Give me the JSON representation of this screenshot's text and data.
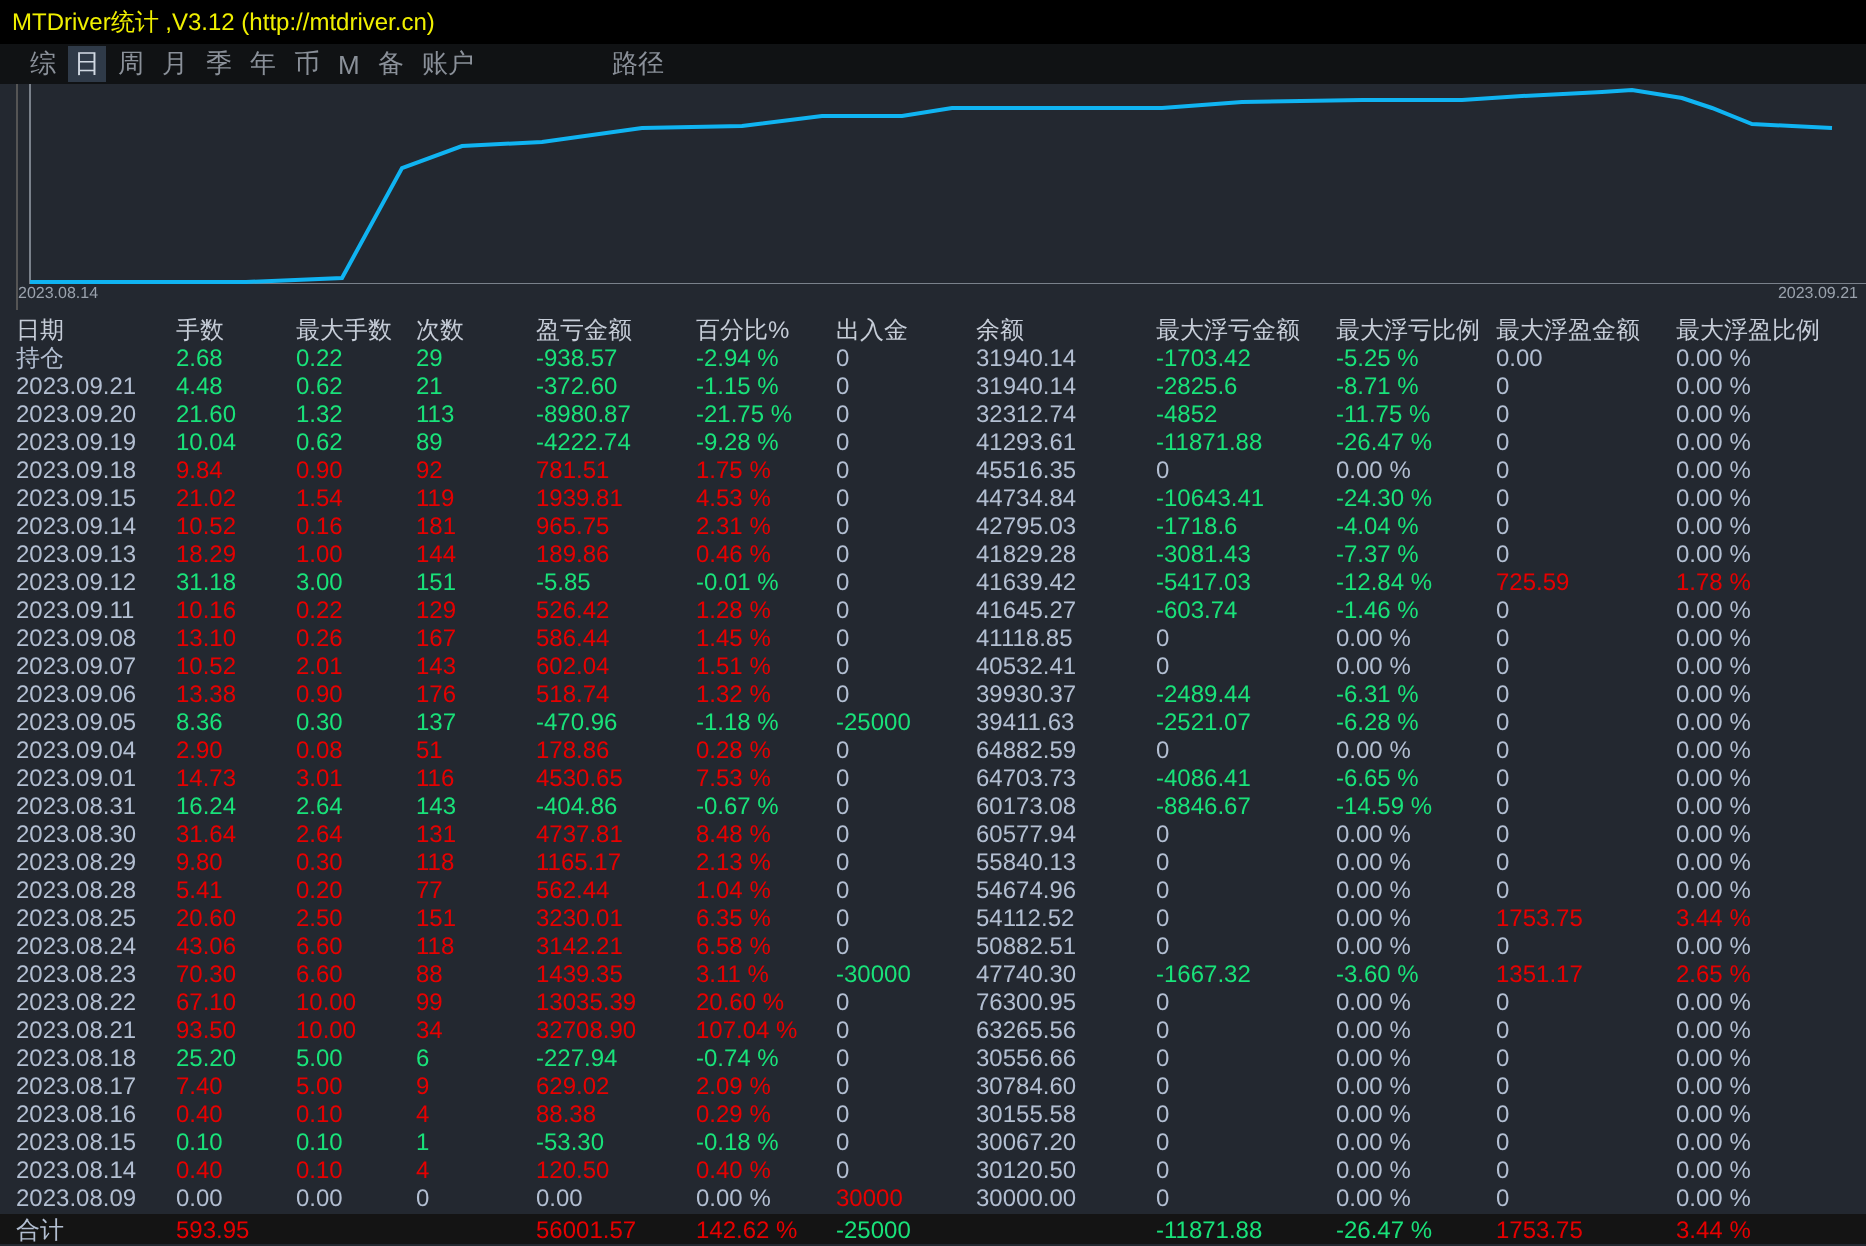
{
  "window": {
    "title": "MTDriver统计 ,V3.12 (http://mtdriver.cn)"
  },
  "tabs": [
    {
      "label": "综",
      "selected": false
    },
    {
      "label": "日",
      "selected": true
    },
    {
      "label": "周",
      "selected": false
    },
    {
      "label": "月",
      "selected": false
    },
    {
      "label": "季",
      "selected": false
    },
    {
      "label": "年",
      "selected": false
    },
    {
      "label": "币",
      "selected": false
    },
    {
      "label": "M",
      "selected": false
    },
    {
      "label": "备",
      "selected": false
    },
    {
      "label": "账户",
      "selected": false
    }
  ],
  "path_tab": {
    "label": "路径",
    "selected": false
  },
  "chart": {
    "start_label": "2023.08.14",
    "end_label": "2023.09.21"
  },
  "table": {
    "columns": [
      "日期",
      "手数",
      "最大手数",
      "次数",
      "盈亏金额",
      "百分比%",
      "出入金",
      "余额",
      "最大浮亏金额",
      "最大浮亏比例",
      "最大浮盈金额",
      "最大浮盈比例"
    ],
    "rows": [
      {
        "kind": "position",
        "cells": [
          {
            "text": "持仓",
            "color": "#b3bfd2"
          },
          {
            "text": "2.68",
            "color": "#19e27a"
          },
          {
            "text": "0.22",
            "color": "#19e27a"
          },
          {
            "text": "29",
            "color": "#19e27a"
          },
          {
            "text": "-938.57",
            "color": "#19e27a"
          },
          {
            "text": "-2.94 %",
            "color": "#19e27a"
          },
          {
            "text": "0",
            "color": "#b3bfd2"
          },
          {
            "text": "31940.14",
            "color": "#b3bfd2"
          },
          {
            "text": "-1703.42",
            "color": "#19e27a"
          },
          {
            "text": "-5.25 %",
            "color": "#19e27a"
          },
          {
            "text": "0.00",
            "color": "#b3bfd2"
          },
          {
            "text": "0.00 %",
            "color": "#b3bfd2"
          }
        ]
      },
      {
        "kind": "day",
        "cells": [
          {
            "text": "2023.09.21",
            "color": "#b3bfd2"
          },
          {
            "text": "4.48",
            "color": "#19e27a"
          },
          {
            "text": "0.62",
            "color": "#19e27a"
          },
          {
            "text": "21",
            "color": "#19e27a"
          },
          {
            "text": "-372.60",
            "color": "#19e27a"
          },
          {
            "text": "-1.15 %",
            "color": "#19e27a"
          },
          {
            "text": "0",
            "color": "#b3bfd2"
          },
          {
            "text": "31940.14",
            "color": "#b3bfd2"
          },
          {
            "text": "-2825.6",
            "color": "#19e27a"
          },
          {
            "text": "-8.71 %",
            "color": "#19e27a"
          },
          {
            "text": "0",
            "color": "#b3bfd2"
          },
          {
            "text": "0.00 %",
            "color": "#b3bfd2"
          }
        ]
      },
      {
        "kind": "day",
        "cells": [
          {
            "text": "2023.09.20",
            "color": "#b3bfd2"
          },
          {
            "text": "21.60",
            "color": "#19e27a"
          },
          {
            "text": "1.32",
            "color": "#19e27a"
          },
          {
            "text": "113",
            "color": "#19e27a"
          },
          {
            "text": "-8980.87",
            "color": "#19e27a"
          },
          {
            "text": "-21.75 %",
            "color": "#19e27a"
          },
          {
            "text": "0",
            "color": "#b3bfd2"
          },
          {
            "text": "32312.74",
            "color": "#b3bfd2"
          },
          {
            "text": "-4852",
            "color": "#19e27a"
          },
          {
            "text": "-11.75 %",
            "color": "#19e27a"
          },
          {
            "text": "0",
            "color": "#b3bfd2"
          },
          {
            "text": "0.00 %",
            "color": "#b3bfd2"
          }
        ]
      },
      {
        "kind": "day",
        "cells": [
          {
            "text": "2023.09.19",
            "color": "#b3bfd2"
          },
          {
            "text": "10.04",
            "color": "#19e27a"
          },
          {
            "text": "0.62",
            "color": "#19e27a"
          },
          {
            "text": "89",
            "color": "#19e27a"
          },
          {
            "text": "-4222.74",
            "color": "#19e27a"
          },
          {
            "text": "-9.28 %",
            "color": "#19e27a"
          },
          {
            "text": "0",
            "color": "#b3bfd2"
          },
          {
            "text": "41293.61",
            "color": "#b3bfd2"
          },
          {
            "text": "-11871.88",
            "color": "#19e27a"
          },
          {
            "text": "-26.47 %",
            "color": "#19e27a"
          },
          {
            "text": "0",
            "color": "#b3bfd2"
          },
          {
            "text": "0.00 %",
            "color": "#b3bfd2"
          }
        ]
      },
      {
        "kind": "day",
        "cells": [
          {
            "text": "2023.09.18",
            "color": "#b3bfd2"
          },
          {
            "text": "9.84",
            "color": "#e60000"
          },
          {
            "text": "0.90",
            "color": "#e60000"
          },
          {
            "text": "92",
            "color": "#e60000"
          },
          {
            "text": "781.51",
            "color": "#e60000"
          },
          {
            "text": "1.75 %",
            "color": "#e60000"
          },
          {
            "text": "0",
            "color": "#b3bfd2"
          },
          {
            "text": "45516.35",
            "color": "#b3bfd2"
          },
          {
            "text": "0",
            "color": "#b3bfd2"
          },
          {
            "text": "0.00 %",
            "color": "#b3bfd2"
          },
          {
            "text": "0",
            "color": "#b3bfd2"
          },
          {
            "text": "0.00 %",
            "color": "#b3bfd2"
          }
        ]
      },
      {
        "kind": "day",
        "cells": [
          {
            "text": "2023.09.15",
            "color": "#b3bfd2"
          },
          {
            "text": "21.02",
            "color": "#e60000"
          },
          {
            "text": "1.54",
            "color": "#e60000"
          },
          {
            "text": "119",
            "color": "#e60000"
          },
          {
            "text": "1939.81",
            "color": "#e60000"
          },
          {
            "text": "4.53 %",
            "color": "#e60000"
          },
          {
            "text": "0",
            "color": "#b3bfd2"
          },
          {
            "text": "44734.84",
            "color": "#b3bfd2"
          },
          {
            "text": "-10643.41",
            "color": "#19e27a"
          },
          {
            "text": "-24.30 %",
            "color": "#19e27a"
          },
          {
            "text": "0",
            "color": "#b3bfd2"
          },
          {
            "text": "0.00 %",
            "color": "#b3bfd2"
          }
        ]
      },
      {
        "kind": "day",
        "cells": [
          {
            "text": "2023.09.14",
            "color": "#b3bfd2"
          },
          {
            "text": "10.52",
            "color": "#e60000"
          },
          {
            "text": "0.16",
            "color": "#e60000"
          },
          {
            "text": "181",
            "color": "#e60000"
          },
          {
            "text": "965.75",
            "color": "#e60000"
          },
          {
            "text": "2.31 %",
            "color": "#e60000"
          },
          {
            "text": "0",
            "color": "#b3bfd2"
          },
          {
            "text": "42795.03",
            "color": "#b3bfd2"
          },
          {
            "text": "-1718.6",
            "color": "#19e27a"
          },
          {
            "text": "-4.04 %",
            "color": "#19e27a"
          },
          {
            "text": "0",
            "color": "#b3bfd2"
          },
          {
            "text": "0.00 %",
            "color": "#b3bfd2"
          }
        ]
      },
      {
        "kind": "day",
        "cells": [
          {
            "text": "2023.09.13",
            "color": "#b3bfd2"
          },
          {
            "text": "18.29",
            "color": "#e60000"
          },
          {
            "text": "1.00",
            "color": "#e60000"
          },
          {
            "text": "144",
            "color": "#e60000"
          },
          {
            "text": "189.86",
            "color": "#e60000"
          },
          {
            "text": "0.46 %",
            "color": "#e60000"
          },
          {
            "text": "0",
            "color": "#b3bfd2"
          },
          {
            "text": "41829.28",
            "color": "#b3bfd2"
          },
          {
            "text": "-3081.43",
            "color": "#19e27a"
          },
          {
            "text": "-7.37 %",
            "color": "#19e27a"
          },
          {
            "text": "0",
            "color": "#b3bfd2"
          },
          {
            "text": "0.00 %",
            "color": "#b3bfd2"
          }
        ]
      },
      {
        "kind": "day",
        "cells": [
          {
            "text": "2023.09.12",
            "color": "#b3bfd2"
          },
          {
            "text": "31.18",
            "color": "#19e27a"
          },
          {
            "text": "3.00",
            "color": "#19e27a"
          },
          {
            "text": "151",
            "color": "#19e27a"
          },
          {
            "text": "-5.85",
            "color": "#19e27a"
          },
          {
            "text": "-0.01 %",
            "color": "#19e27a"
          },
          {
            "text": "0",
            "color": "#b3bfd2"
          },
          {
            "text": "41639.42",
            "color": "#b3bfd2"
          },
          {
            "text": "-5417.03",
            "color": "#19e27a"
          },
          {
            "text": "-12.84 %",
            "color": "#19e27a"
          },
          {
            "text": "725.59",
            "color": "#e60000"
          },
          {
            "text": "1.78 %",
            "color": "#e60000"
          }
        ]
      },
      {
        "kind": "day",
        "cells": [
          {
            "text": "2023.09.11",
            "color": "#b3bfd2"
          },
          {
            "text": "10.16",
            "color": "#e60000"
          },
          {
            "text": "0.22",
            "color": "#e60000"
          },
          {
            "text": "129",
            "color": "#e60000"
          },
          {
            "text": "526.42",
            "color": "#e60000"
          },
          {
            "text": "1.28 %",
            "color": "#e60000"
          },
          {
            "text": "0",
            "color": "#b3bfd2"
          },
          {
            "text": "41645.27",
            "color": "#b3bfd2"
          },
          {
            "text": "-603.74",
            "color": "#19e27a"
          },
          {
            "text": "-1.46 %",
            "color": "#19e27a"
          },
          {
            "text": "0",
            "color": "#b3bfd2"
          },
          {
            "text": "0.00 %",
            "color": "#b3bfd2"
          }
        ]
      },
      {
        "kind": "day",
        "cells": [
          {
            "text": "2023.09.08",
            "color": "#b3bfd2"
          },
          {
            "text": "13.10",
            "color": "#e60000"
          },
          {
            "text": "0.26",
            "color": "#e60000"
          },
          {
            "text": "167",
            "color": "#e60000"
          },
          {
            "text": "586.44",
            "color": "#e60000"
          },
          {
            "text": "1.45 %",
            "color": "#e60000"
          },
          {
            "text": "0",
            "color": "#b3bfd2"
          },
          {
            "text": "41118.85",
            "color": "#b3bfd2"
          },
          {
            "text": "0",
            "color": "#b3bfd2"
          },
          {
            "text": "0.00 %",
            "color": "#b3bfd2"
          },
          {
            "text": "0",
            "color": "#b3bfd2"
          },
          {
            "text": "0.00 %",
            "color": "#b3bfd2"
          }
        ]
      },
      {
        "kind": "day",
        "cells": [
          {
            "text": "2023.09.07",
            "color": "#b3bfd2"
          },
          {
            "text": "10.52",
            "color": "#e60000"
          },
          {
            "text": "2.01",
            "color": "#e60000"
          },
          {
            "text": "143",
            "color": "#e60000"
          },
          {
            "text": "602.04",
            "color": "#e60000"
          },
          {
            "text": "1.51 %",
            "color": "#e60000"
          },
          {
            "text": "0",
            "color": "#b3bfd2"
          },
          {
            "text": "40532.41",
            "color": "#b3bfd2"
          },
          {
            "text": "0",
            "color": "#b3bfd2"
          },
          {
            "text": "0.00 %",
            "color": "#b3bfd2"
          },
          {
            "text": "0",
            "color": "#b3bfd2"
          },
          {
            "text": "0.00 %",
            "color": "#b3bfd2"
          }
        ]
      },
      {
        "kind": "day",
        "cells": [
          {
            "text": "2023.09.06",
            "color": "#b3bfd2"
          },
          {
            "text": "13.38",
            "color": "#e60000"
          },
          {
            "text": "0.90",
            "color": "#e60000"
          },
          {
            "text": "176",
            "color": "#e60000"
          },
          {
            "text": "518.74",
            "color": "#e60000"
          },
          {
            "text": "1.32 %",
            "color": "#e60000"
          },
          {
            "text": "0",
            "color": "#b3bfd2"
          },
          {
            "text": "39930.37",
            "color": "#b3bfd2"
          },
          {
            "text": "-2489.44",
            "color": "#19e27a"
          },
          {
            "text": "-6.31 %",
            "color": "#19e27a"
          },
          {
            "text": "0",
            "color": "#b3bfd2"
          },
          {
            "text": "0.00 %",
            "color": "#b3bfd2"
          }
        ]
      },
      {
        "kind": "day",
        "cells": [
          {
            "text": "2023.09.05",
            "color": "#b3bfd2"
          },
          {
            "text": "8.36",
            "color": "#19e27a"
          },
          {
            "text": "0.30",
            "color": "#19e27a"
          },
          {
            "text": "137",
            "color": "#19e27a"
          },
          {
            "text": "-470.96",
            "color": "#19e27a"
          },
          {
            "text": "-1.18 %",
            "color": "#19e27a"
          },
          {
            "text": "-25000",
            "color": "#19e27a"
          },
          {
            "text": "39411.63",
            "color": "#b3bfd2"
          },
          {
            "text": "-2521.07",
            "color": "#19e27a"
          },
          {
            "text": "-6.28 %",
            "color": "#19e27a"
          },
          {
            "text": "0",
            "color": "#b3bfd2"
          },
          {
            "text": "0.00 %",
            "color": "#b3bfd2"
          }
        ]
      },
      {
        "kind": "day",
        "cells": [
          {
            "text": "2023.09.04",
            "color": "#b3bfd2"
          },
          {
            "text": "2.90",
            "color": "#e60000"
          },
          {
            "text": "0.08",
            "color": "#e60000"
          },
          {
            "text": "51",
            "color": "#e60000"
          },
          {
            "text": "178.86",
            "color": "#e60000"
          },
          {
            "text": "0.28 %",
            "color": "#e60000"
          },
          {
            "text": "0",
            "color": "#b3bfd2"
          },
          {
            "text": "64882.59",
            "color": "#b3bfd2"
          },
          {
            "text": "0",
            "color": "#b3bfd2"
          },
          {
            "text": "0.00 %",
            "color": "#b3bfd2"
          },
          {
            "text": "0",
            "color": "#b3bfd2"
          },
          {
            "text": "0.00 %",
            "color": "#b3bfd2"
          }
        ]
      },
      {
        "kind": "day",
        "cells": [
          {
            "text": "2023.09.01",
            "color": "#b3bfd2"
          },
          {
            "text": "14.73",
            "color": "#e60000"
          },
          {
            "text": "3.01",
            "color": "#e60000"
          },
          {
            "text": "116",
            "color": "#e60000"
          },
          {
            "text": "4530.65",
            "color": "#e60000"
          },
          {
            "text": "7.53 %",
            "color": "#e60000"
          },
          {
            "text": "0",
            "color": "#b3bfd2"
          },
          {
            "text": "64703.73",
            "color": "#b3bfd2"
          },
          {
            "text": "-4086.41",
            "color": "#19e27a"
          },
          {
            "text": "-6.65 %",
            "color": "#19e27a"
          },
          {
            "text": "0",
            "color": "#b3bfd2"
          },
          {
            "text": "0.00 %",
            "color": "#b3bfd2"
          }
        ]
      },
      {
        "kind": "day",
        "cells": [
          {
            "text": "2023.08.31",
            "color": "#b3bfd2"
          },
          {
            "text": "16.24",
            "color": "#19e27a"
          },
          {
            "text": "2.64",
            "color": "#19e27a"
          },
          {
            "text": "143",
            "color": "#19e27a"
          },
          {
            "text": "-404.86",
            "color": "#19e27a"
          },
          {
            "text": "-0.67 %",
            "color": "#19e27a"
          },
          {
            "text": "0",
            "color": "#b3bfd2"
          },
          {
            "text": "60173.08",
            "color": "#b3bfd2"
          },
          {
            "text": "-8846.67",
            "color": "#19e27a"
          },
          {
            "text": "-14.59 %",
            "color": "#19e27a"
          },
          {
            "text": "0",
            "color": "#b3bfd2"
          },
          {
            "text": "0.00 %",
            "color": "#b3bfd2"
          }
        ]
      },
      {
        "kind": "day",
        "cells": [
          {
            "text": "2023.08.30",
            "color": "#b3bfd2"
          },
          {
            "text": "31.64",
            "color": "#e60000"
          },
          {
            "text": "2.64",
            "color": "#e60000"
          },
          {
            "text": "131",
            "color": "#e60000"
          },
          {
            "text": "4737.81",
            "color": "#e60000"
          },
          {
            "text": "8.48 %",
            "color": "#e60000"
          },
          {
            "text": "0",
            "color": "#b3bfd2"
          },
          {
            "text": "60577.94",
            "color": "#b3bfd2"
          },
          {
            "text": "0",
            "color": "#b3bfd2"
          },
          {
            "text": "0.00 %",
            "color": "#b3bfd2"
          },
          {
            "text": "0",
            "color": "#b3bfd2"
          },
          {
            "text": "0.00 %",
            "color": "#b3bfd2"
          }
        ]
      },
      {
        "kind": "day",
        "cells": [
          {
            "text": "2023.08.29",
            "color": "#b3bfd2"
          },
          {
            "text": "9.80",
            "color": "#e60000"
          },
          {
            "text": "0.30",
            "color": "#e60000"
          },
          {
            "text": "118",
            "color": "#e60000"
          },
          {
            "text": "1165.17",
            "color": "#e60000"
          },
          {
            "text": "2.13 %",
            "color": "#e60000"
          },
          {
            "text": "0",
            "color": "#b3bfd2"
          },
          {
            "text": "55840.13",
            "color": "#b3bfd2"
          },
          {
            "text": "0",
            "color": "#b3bfd2"
          },
          {
            "text": "0.00 %",
            "color": "#b3bfd2"
          },
          {
            "text": "0",
            "color": "#b3bfd2"
          },
          {
            "text": "0.00 %",
            "color": "#b3bfd2"
          }
        ]
      },
      {
        "kind": "day",
        "cells": [
          {
            "text": "2023.08.28",
            "color": "#b3bfd2"
          },
          {
            "text": "5.41",
            "color": "#e60000"
          },
          {
            "text": "0.20",
            "color": "#e60000"
          },
          {
            "text": "77",
            "color": "#e60000"
          },
          {
            "text": "562.44",
            "color": "#e60000"
          },
          {
            "text": "1.04 %",
            "color": "#e60000"
          },
          {
            "text": "0",
            "color": "#b3bfd2"
          },
          {
            "text": "54674.96",
            "color": "#b3bfd2"
          },
          {
            "text": "0",
            "color": "#b3bfd2"
          },
          {
            "text": "0.00 %",
            "color": "#b3bfd2"
          },
          {
            "text": "0",
            "color": "#b3bfd2"
          },
          {
            "text": "0.00 %",
            "color": "#b3bfd2"
          }
        ]
      },
      {
        "kind": "day",
        "cells": [
          {
            "text": "2023.08.25",
            "color": "#b3bfd2"
          },
          {
            "text": "20.60",
            "color": "#e60000"
          },
          {
            "text": "2.50",
            "color": "#e60000"
          },
          {
            "text": "151",
            "color": "#e60000"
          },
          {
            "text": "3230.01",
            "color": "#e60000"
          },
          {
            "text": "6.35 %",
            "color": "#e60000"
          },
          {
            "text": "0",
            "color": "#b3bfd2"
          },
          {
            "text": "54112.52",
            "color": "#b3bfd2"
          },
          {
            "text": "0",
            "color": "#b3bfd2"
          },
          {
            "text": "0.00 %",
            "color": "#b3bfd2"
          },
          {
            "text": "1753.75",
            "color": "#e60000"
          },
          {
            "text": "3.44 %",
            "color": "#e60000"
          }
        ]
      },
      {
        "kind": "day",
        "cells": [
          {
            "text": "2023.08.24",
            "color": "#b3bfd2"
          },
          {
            "text": "43.06",
            "color": "#e60000"
          },
          {
            "text": "6.60",
            "color": "#e60000"
          },
          {
            "text": "118",
            "color": "#e60000"
          },
          {
            "text": "3142.21",
            "color": "#e60000"
          },
          {
            "text": "6.58 %",
            "color": "#e60000"
          },
          {
            "text": "0",
            "color": "#b3bfd2"
          },
          {
            "text": "50882.51",
            "color": "#b3bfd2"
          },
          {
            "text": "0",
            "color": "#b3bfd2"
          },
          {
            "text": "0.00 %",
            "color": "#b3bfd2"
          },
          {
            "text": "0",
            "color": "#b3bfd2"
          },
          {
            "text": "0.00 %",
            "color": "#b3bfd2"
          }
        ]
      },
      {
        "kind": "day",
        "cells": [
          {
            "text": "2023.08.23",
            "color": "#b3bfd2"
          },
          {
            "text": "70.30",
            "color": "#e60000"
          },
          {
            "text": "6.60",
            "color": "#e60000"
          },
          {
            "text": "88",
            "color": "#e60000"
          },
          {
            "text": "1439.35",
            "color": "#e60000"
          },
          {
            "text": "3.11 %",
            "color": "#e60000"
          },
          {
            "text": "-30000",
            "color": "#19e27a"
          },
          {
            "text": "47740.30",
            "color": "#b3bfd2"
          },
          {
            "text": "-1667.32",
            "color": "#19e27a"
          },
          {
            "text": "-3.60 %",
            "color": "#19e27a"
          },
          {
            "text": "1351.17",
            "color": "#e60000"
          },
          {
            "text": "2.65 %",
            "color": "#e60000"
          }
        ]
      },
      {
        "kind": "day",
        "cells": [
          {
            "text": "2023.08.22",
            "color": "#b3bfd2"
          },
          {
            "text": "67.10",
            "color": "#e60000"
          },
          {
            "text": "10.00",
            "color": "#e60000"
          },
          {
            "text": "99",
            "color": "#e60000"
          },
          {
            "text": "13035.39",
            "color": "#e60000"
          },
          {
            "text": "20.60 %",
            "color": "#e60000"
          },
          {
            "text": "0",
            "color": "#b3bfd2"
          },
          {
            "text": "76300.95",
            "color": "#b3bfd2"
          },
          {
            "text": "0",
            "color": "#b3bfd2"
          },
          {
            "text": "0.00 %",
            "color": "#b3bfd2"
          },
          {
            "text": "0",
            "color": "#b3bfd2"
          },
          {
            "text": "0.00 %",
            "color": "#b3bfd2"
          }
        ]
      },
      {
        "kind": "day",
        "cells": [
          {
            "text": "2023.08.21",
            "color": "#b3bfd2"
          },
          {
            "text": "93.50",
            "color": "#e60000"
          },
          {
            "text": "10.00",
            "color": "#e60000"
          },
          {
            "text": "34",
            "color": "#e60000"
          },
          {
            "text": "32708.90",
            "color": "#e60000"
          },
          {
            "text": "107.04 %",
            "color": "#e60000"
          },
          {
            "text": "0",
            "color": "#b3bfd2"
          },
          {
            "text": "63265.56",
            "color": "#b3bfd2"
          },
          {
            "text": "0",
            "color": "#b3bfd2"
          },
          {
            "text": "0.00 %",
            "color": "#b3bfd2"
          },
          {
            "text": "0",
            "color": "#b3bfd2"
          },
          {
            "text": "0.00 %",
            "color": "#b3bfd2"
          }
        ]
      },
      {
        "kind": "day",
        "cells": [
          {
            "text": "2023.08.18",
            "color": "#b3bfd2"
          },
          {
            "text": "25.20",
            "color": "#19e27a"
          },
          {
            "text": "5.00",
            "color": "#19e27a"
          },
          {
            "text": "6",
            "color": "#19e27a"
          },
          {
            "text": "-227.94",
            "color": "#19e27a"
          },
          {
            "text": "-0.74 %",
            "color": "#19e27a"
          },
          {
            "text": "0",
            "color": "#b3bfd2"
          },
          {
            "text": "30556.66",
            "color": "#b3bfd2"
          },
          {
            "text": "0",
            "color": "#b3bfd2"
          },
          {
            "text": "0.00 %",
            "color": "#b3bfd2"
          },
          {
            "text": "0",
            "color": "#b3bfd2"
          },
          {
            "text": "0.00 %",
            "color": "#b3bfd2"
          }
        ]
      },
      {
        "kind": "day",
        "cells": [
          {
            "text": "2023.08.17",
            "color": "#b3bfd2"
          },
          {
            "text": "7.40",
            "color": "#e60000"
          },
          {
            "text": "5.00",
            "color": "#e60000"
          },
          {
            "text": "9",
            "color": "#e60000"
          },
          {
            "text": "629.02",
            "color": "#e60000"
          },
          {
            "text": "2.09 %",
            "color": "#e60000"
          },
          {
            "text": "0",
            "color": "#b3bfd2"
          },
          {
            "text": "30784.60",
            "color": "#b3bfd2"
          },
          {
            "text": "0",
            "color": "#b3bfd2"
          },
          {
            "text": "0.00 %",
            "color": "#b3bfd2"
          },
          {
            "text": "0",
            "color": "#b3bfd2"
          },
          {
            "text": "0.00 %",
            "color": "#b3bfd2"
          }
        ]
      },
      {
        "kind": "day",
        "cells": [
          {
            "text": "2023.08.16",
            "color": "#b3bfd2"
          },
          {
            "text": "0.40",
            "color": "#e60000"
          },
          {
            "text": "0.10",
            "color": "#e60000"
          },
          {
            "text": "4",
            "color": "#e60000"
          },
          {
            "text": "88.38",
            "color": "#e60000"
          },
          {
            "text": "0.29 %",
            "color": "#e60000"
          },
          {
            "text": "0",
            "color": "#b3bfd2"
          },
          {
            "text": "30155.58",
            "color": "#b3bfd2"
          },
          {
            "text": "0",
            "color": "#b3bfd2"
          },
          {
            "text": "0.00 %",
            "color": "#b3bfd2"
          },
          {
            "text": "0",
            "color": "#b3bfd2"
          },
          {
            "text": "0.00 %",
            "color": "#b3bfd2"
          }
        ]
      },
      {
        "kind": "day",
        "cells": [
          {
            "text": "2023.08.15",
            "color": "#b3bfd2"
          },
          {
            "text": "0.10",
            "color": "#19e27a"
          },
          {
            "text": "0.10",
            "color": "#19e27a"
          },
          {
            "text": "1",
            "color": "#19e27a"
          },
          {
            "text": "-53.30",
            "color": "#19e27a"
          },
          {
            "text": "-0.18 %",
            "color": "#19e27a"
          },
          {
            "text": "0",
            "color": "#b3bfd2"
          },
          {
            "text": "30067.20",
            "color": "#b3bfd2"
          },
          {
            "text": "0",
            "color": "#b3bfd2"
          },
          {
            "text": "0.00 %",
            "color": "#b3bfd2"
          },
          {
            "text": "0",
            "color": "#b3bfd2"
          },
          {
            "text": "0.00 %",
            "color": "#b3bfd2"
          }
        ]
      },
      {
        "kind": "day",
        "cells": [
          {
            "text": "2023.08.14",
            "color": "#b3bfd2"
          },
          {
            "text": "0.40",
            "color": "#e60000"
          },
          {
            "text": "0.10",
            "color": "#e60000"
          },
          {
            "text": "4",
            "color": "#e60000"
          },
          {
            "text": "120.50",
            "color": "#e60000"
          },
          {
            "text": "0.40 %",
            "color": "#e60000"
          },
          {
            "text": "0",
            "color": "#b3bfd2"
          },
          {
            "text": "30120.50",
            "color": "#b3bfd2"
          },
          {
            "text": "0",
            "color": "#b3bfd2"
          },
          {
            "text": "0.00 %",
            "color": "#b3bfd2"
          },
          {
            "text": "0",
            "color": "#b3bfd2"
          },
          {
            "text": "0.00 %",
            "color": "#b3bfd2"
          }
        ]
      },
      {
        "kind": "day",
        "cells": [
          {
            "text": "2023.08.09",
            "color": "#b3bfd2"
          },
          {
            "text": "0.00",
            "color": "#b3bfd2"
          },
          {
            "text": "0.00",
            "color": "#b3bfd2"
          },
          {
            "text": "0",
            "color": "#b3bfd2"
          },
          {
            "text": "0.00",
            "color": "#b3bfd2"
          },
          {
            "text": "0.00 %",
            "color": "#b3bfd2"
          },
          {
            "text": "30000",
            "color": "#e60000"
          },
          {
            "text": "30000.00",
            "color": "#b3bfd2"
          },
          {
            "text": "0",
            "color": "#b3bfd2"
          },
          {
            "text": "0.00 %",
            "color": "#b3bfd2"
          },
          {
            "text": "0",
            "color": "#b3bfd2"
          },
          {
            "text": "0.00 %",
            "color": "#b3bfd2"
          }
        ]
      },
      {
        "kind": "total",
        "cells": [
          {
            "text": "合计",
            "color": "#b3bfd2"
          },
          {
            "text": "593.95",
            "color": "#e60000"
          },
          null,
          null,
          {
            "text": "56001.57",
            "color": "#e60000"
          },
          {
            "text": "142.62 %",
            "color": "#e60000"
          },
          {
            "text": "-25000",
            "color": "#19e27a"
          },
          null,
          {
            "text": "-11871.88",
            "color": "#19e27a"
          },
          {
            "text": "-26.47 %",
            "color": "#19e27a"
          },
          {
            "text": "1753.75",
            "color": "#e60000"
          },
          {
            "text": "3.44 %",
            "color": "#e60000"
          }
        ]
      }
    ]
  }
}
